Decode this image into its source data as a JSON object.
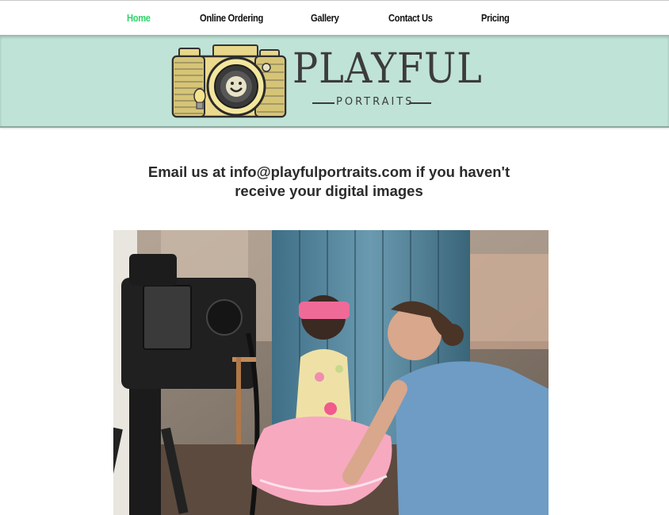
{
  "nav": {
    "items": [
      {
        "label": "Home",
        "active": true
      },
      {
        "label": "Online Ordering",
        "active": false
      },
      {
        "label": "Gallery",
        "active": false
      },
      {
        "label": "Contact Us",
        "active": false
      },
      {
        "label": "Pricing",
        "active": false
      }
    ],
    "active_color": "#2fd56a"
  },
  "header": {
    "logo_title": "PLAYFUL",
    "logo_subtitle": "PORTRAITS",
    "logo_icon": "camera-icon",
    "background_color": "#bfe3d6"
  },
  "main": {
    "message": "Email us at info@playfulportraits.com if you haven't receive your digital images"
  },
  "photo": {
    "subject": "photographer-with-child-image"
  }
}
